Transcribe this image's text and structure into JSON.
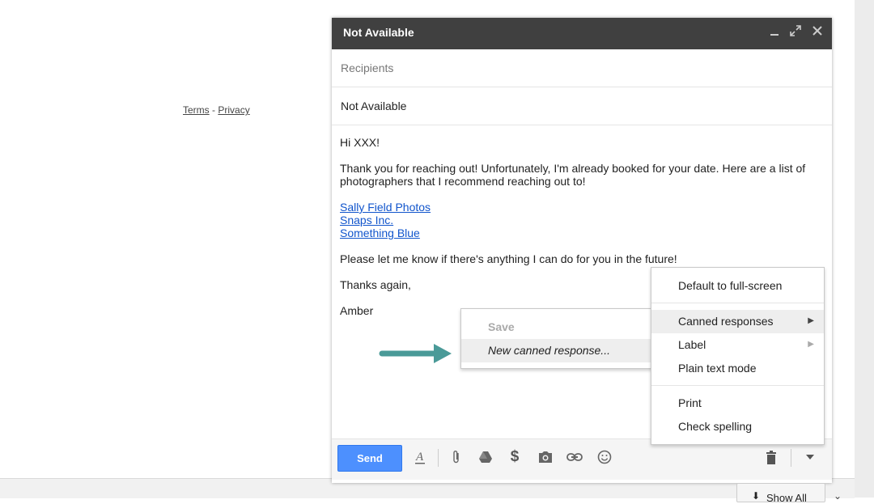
{
  "footer": {
    "terms": "Terms",
    "sep": "-",
    "privacy": "Privacy"
  },
  "compose": {
    "title": "Not Available",
    "icons": {
      "minimize": "minimize-icon",
      "expand": "expand-icon",
      "close": "close-icon"
    },
    "recipients_placeholder": "Recipients",
    "subject": "Not Available",
    "body": {
      "greeting": "Hi XXX!",
      "paragraph1": "Thank you for reaching out! Unfortunately, I'm already booked for your date. Here are a list of photographers that I recommend reaching out to!",
      "links": [
        "Sally Field Photos",
        "Snaps Inc.",
        "Something Blue"
      ],
      "paragraph2": "Please let me know if there's anything I can do for you in the future!",
      "thanks": "Thanks again,",
      "signature": "Amber"
    },
    "toolbar": {
      "send_label": "Send",
      "icons": [
        "format-text-icon",
        "attach-icon",
        "drive-icon",
        "money-icon",
        "photo-icon",
        "link-icon",
        "emoji-icon",
        "trash-icon",
        "more-options-icon"
      ]
    }
  },
  "more_menu": {
    "items": [
      {
        "label": "Default to full-screen"
      },
      {
        "label": "Canned responses",
        "submenu": true,
        "highlighted": true
      },
      {
        "label": "Label",
        "submenu": true
      },
      {
        "label": "Plain text mode"
      },
      {
        "label": "Print"
      },
      {
        "label": "Check spelling"
      }
    ]
  },
  "canned_submenu": {
    "save_label": "Save",
    "new_label": "New canned response..."
  },
  "bottom": {
    "show_all": "Show All"
  },
  "colors": {
    "header_bg": "#404040",
    "send_blue": "#4d90fe",
    "link_blue": "#1155cc",
    "arrow_teal": "#4a9a98"
  }
}
